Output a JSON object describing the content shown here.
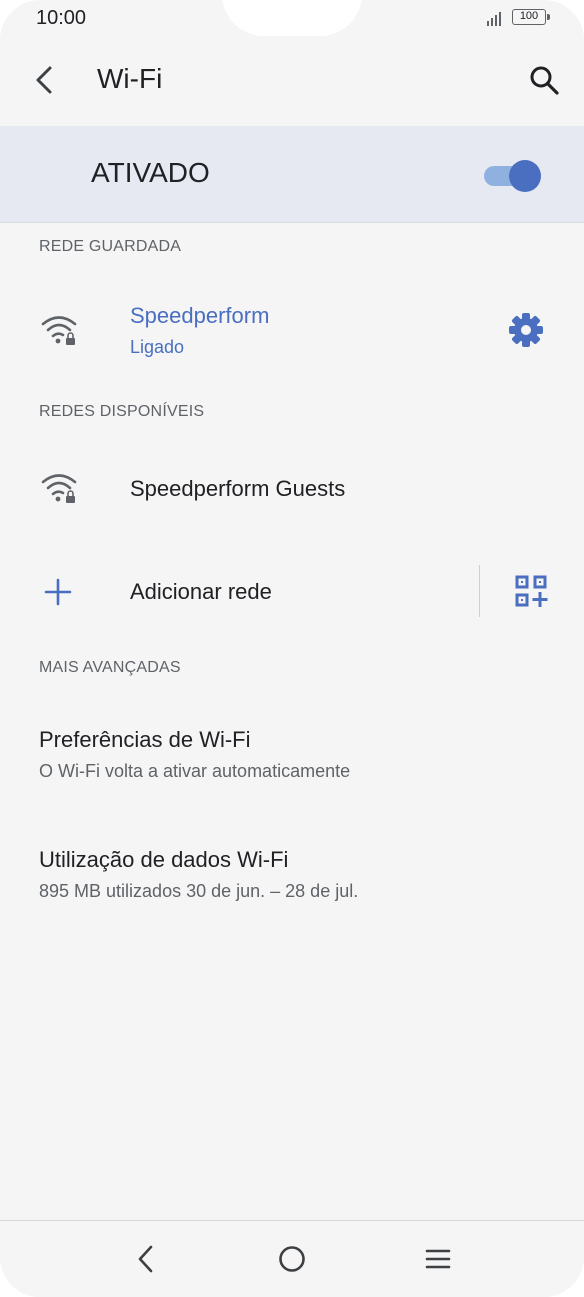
{
  "status_bar": {
    "time": "10:00",
    "battery": "100"
  },
  "header": {
    "title": "Wi-Fi"
  },
  "master_toggle": {
    "label": "ATIVADO",
    "on": true
  },
  "saved_section": {
    "header": "REDE GUARDADA",
    "network": {
      "name": "Speedperform",
      "status": "Ligado"
    }
  },
  "available_section": {
    "header": "REDES DISPONÍVEIS",
    "networks": [
      {
        "name": "Speedperform Guests"
      }
    ]
  },
  "add_network": {
    "label": "Adicionar rede"
  },
  "advanced_section": {
    "header": "MAIS AVANÇADAS",
    "items": [
      {
        "title": "Preferências de Wi-Fi",
        "subtitle": "O Wi-Fi volta a ativar automaticamente"
      },
      {
        "title": "Utilização de dados Wi-Fi",
        "subtitle": "895 MB utilizados 30 de jun. – 28 de jul."
      }
    ]
  },
  "colors": {
    "accent": "#4a6fc0",
    "toggle_track": "#8fb1e0",
    "toggle_bar_bg": "#e6e9f2",
    "background": "#f5f5f5"
  }
}
